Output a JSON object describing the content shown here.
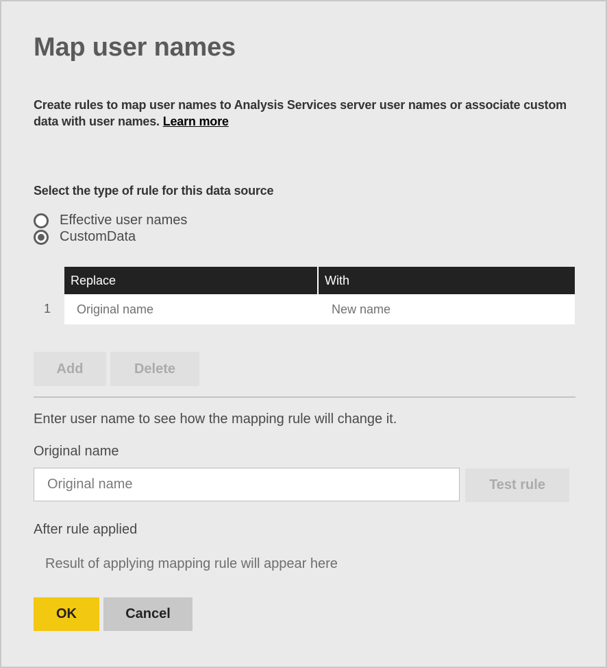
{
  "dialog": {
    "title": "Map user names",
    "description": "Create rules to map user names to Analysis Services server user names or associate custom data with user names.",
    "learn_more": "Learn more"
  },
  "rule_type": {
    "label": "Select the type of rule for this data source",
    "options": [
      {
        "label": "Effective user names",
        "selected": false
      },
      {
        "label": "CustomData",
        "selected": true
      }
    ]
  },
  "mapping_table": {
    "columns": [
      "Replace",
      "With"
    ],
    "rows": [
      {
        "number": "1",
        "replace_placeholder": "Original name",
        "with_placeholder": "New name"
      }
    ]
  },
  "table_actions": {
    "add": "Add",
    "delete": "Delete"
  },
  "test": {
    "help_text": "Enter user name to see how the mapping rule will change it.",
    "original_label": "Original name",
    "original_placeholder": "Original name",
    "original_value": "",
    "test_button": "Test rule",
    "after_label": "After rule applied",
    "result_text": "Result of applying mapping rule will appear here"
  },
  "footer": {
    "ok": "OK",
    "cancel": "Cancel"
  },
  "colors": {
    "accent": "#f2c811",
    "header_bg": "#222222",
    "dialog_bg": "#eaeaea"
  }
}
